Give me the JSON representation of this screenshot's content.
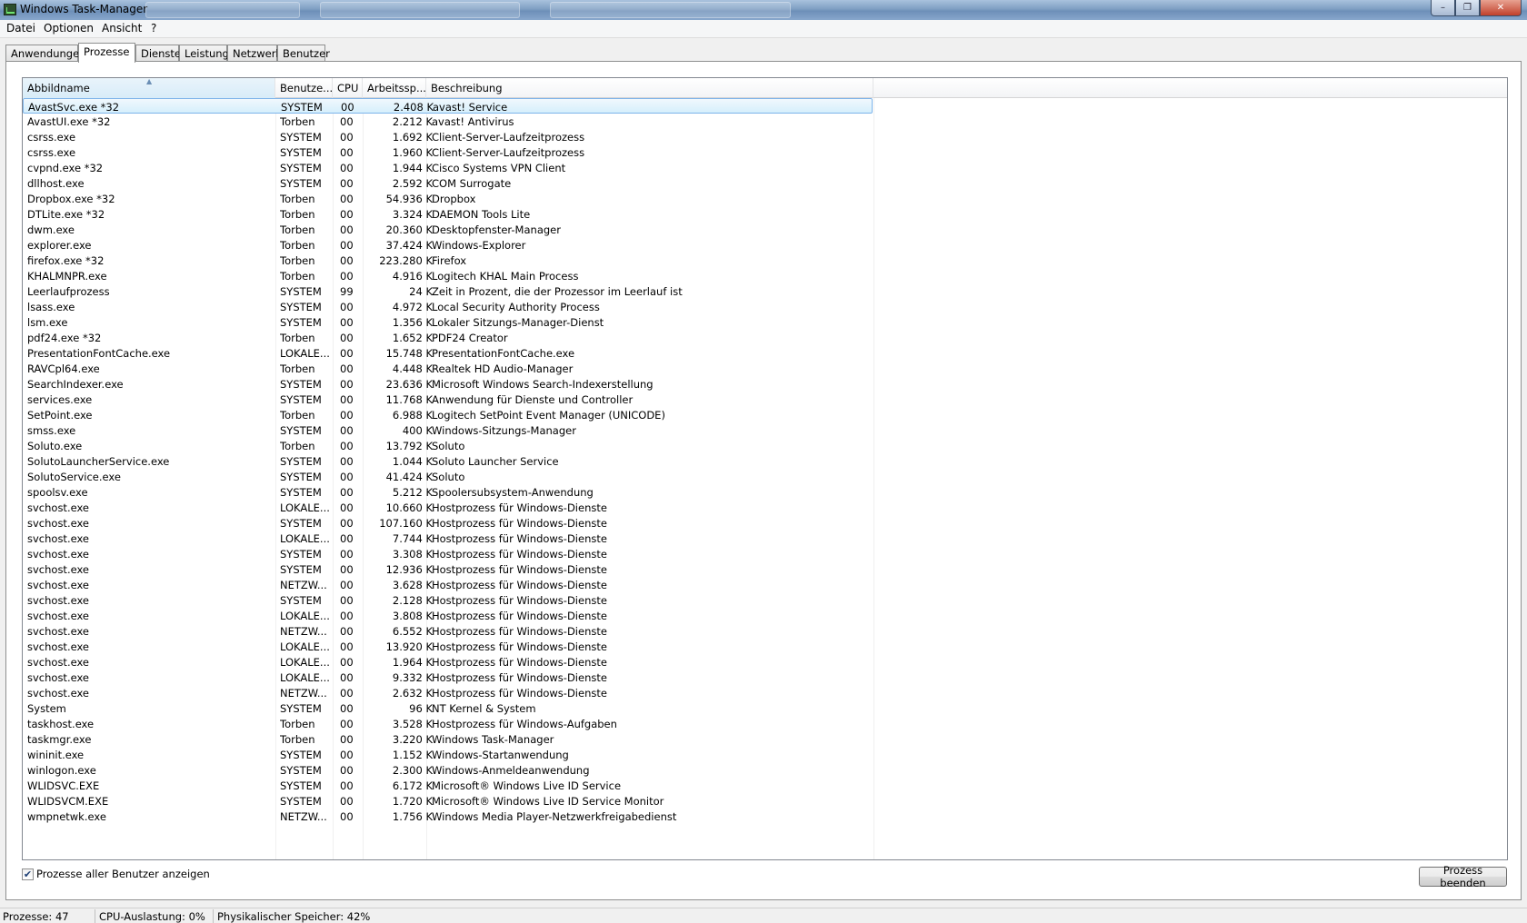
{
  "window": {
    "title": "Windows Task-Manager"
  },
  "menu": [
    "Datei",
    "Optionen",
    "Ansicht",
    "?"
  ],
  "tabs": [
    "Anwendungen",
    "Prozesse",
    "Dienste",
    "Leistung",
    "Netzwerk",
    "Benutzer"
  ],
  "active_tab": "Prozesse",
  "columns": [
    "Abbildname",
    "Benutze...",
    "CPU",
    "Arbeitssp...",
    "Beschreibung"
  ],
  "sorted_column": "Abbildname",
  "processes": [
    [
      "AvastSvc.exe *32",
      "SYSTEM",
      "00",
      "2.408 K",
      "avast! Service"
    ],
    [
      "AvastUI.exe *32",
      "Torben",
      "00",
      "2.212 K",
      "avast! Antivirus"
    ],
    [
      "csrss.exe",
      "SYSTEM",
      "00",
      "1.692 K",
      "Client-Server-Laufzeitprozess"
    ],
    [
      "csrss.exe",
      "SYSTEM",
      "00",
      "1.960 K",
      "Client-Server-Laufzeitprozess"
    ],
    [
      "cvpnd.exe *32",
      "SYSTEM",
      "00",
      "1.944 K",
      "Cisco Systems VPN Client"
    ],
    [
      "dllhost.exe",
      "SYSTEM",
      "00",
      "2.592 K",
      "COM Surrogate"
    ],
    [
      "Dropbox.exe *32",
      "Torben",
      "00",
      "54.936 K",
      "Dropbox"
    ],
    [
      "DTLite.exe *32",
      "Torben",
      "00",
      "3.324 K",
      "DAEMON Tools Lite"
    ],
    [
      "dwm.exe",
      "Torben",
      "00",
      "20.360 K",
      "Desktopfenster-Manager"
    ],
    [
      "explorer.exe",
      "Torben",
      "00",
      "37.424 K",
      "Windows-Explorer"
    ],
    [
      "firefox.exe *32",
      "Torben",
      "00",
      "223.280 K",
      "Firefox"
    ],
    [
      "KHALMNPR.exe",
      "Torben",
      "00",
      "4.916 K",
      "Logitech KHAL Main Process"
    ],
    [
      "Leerlaufprozess",
      "SYSTEM",
      "99",
      "24 K",
      "Zeit in Prozent, die der Prozessor im Leerlauf ist"
    ],
    [
      "lsass.exe",
      "SYSTEM",
      "00",
      "4.972 K",
      "Local Security Authority Process"
    ],
    [
      "lsm.exe",
      "SYSTEM",
      "00",
      "1.356 K",
      "Lokaler Sitzungs-Manager-Dienst"
    ],
    [
      "pdf24.exe *32",
      "Torben",
      "00",
      "1.652 K",
      "PDF24 Creator"
    ],
    [
      "PresentationFontCache.exe",
      "LOKALE...",
      "00",
      "15.748 K",
      "PresentationFontCache.exe"
    ],
    [
      "RAVCpl64.exe",
      "Torben",
      "00",
      "4.448 K",
      "Realtek HD Audio-Manager"
    ],
    [
      "SearchIndexer.exe",
      "SYSTEM",
      "00",
      "23.636 K",
      "Microsoft Windows Search-Indexerstellung"
    ],
    [
      "services.exe",
      "SYSTEM",
      "00",
      "11.768 K",
      "Anwendung für Dienste und Controller"
    ],
    [
      "SetPoint.exe",
      "Torben",
      "00",
      "6.988 K",
      "Logitech SetPoint Event Manager (UNICODE)"
    ],
    [
      "smss.exe",
      "SYSTEM",
      "00",
      "400 K",
      "Windows-Sitzungs-Manager"
    ],
    [
      "Soluto.exe",
      "Torben",
      "00",
      "13.792 K",
      "Soluto"
    ],
    [
      "SolutoLauncherService.exe",
      "SYSTEM",
      "00",
      "1.044 K",
      "Soluto Launcher Service"
    ],
    [
      "SolutoService.exe",
      "SYSTEM",
      "00",
      "41.424 K",
      "Soluto"
    ],
    [
      "spoolsv.exe",
      "SYSTEM",
      "00",
      "5.212 K",
      "Spoolersubsystem-Anwendung"
    ],
    [
      "svchost.exe",
      "LOKALE...",
      "00",
      "10.660 K",
      "Hostprozess für Windows-Dienste"
    ],
    [
      "svchost.exe",
      "SYSTEM",
      "00",
      "107.160 K",
      "Hostprozess für Windows-Dienste"
    ],
    [
      "svchost.exe",
      "LOKALE...",
      "00",
      "7.744 K",
      "Hostprozess für Windows-Dienste"
    ],
    [
      "svchost.exe",
      "SYSTEM",
      "00",
      "3.308 K",
      "Hostprozess für Windows-Dienste"
    ],
    [
      "svchost.exe",
      "SYSTEM",
      "00",
      "12.936 K",
      "Hostprozess für Windows-Dienste"
    ],
    [
      "svchost.exe",
      "NETZW...",
      "00",
      "3.628 K",
      "Hostprozess für Windows-Dienste"
    ],
    [
      "svchost.exe",
      "SYSTEM",
      "00",
      "2.128 K",
      "Hostprozess für Windows-Dienste"
    ],
    [
      "svchost.exe",
      "LOKALE...",
      "00",
      "3.808 K",
      "Hostprozess für Windows-Dienste"
    ],
    [
      "svchost.exe",
      "NETZW...",
      "00",
      "6.552 K",
      "Hostprozess für Windows-Dienste"
    ],
    [
      "svchost.exe",
      "LOKALE...",
      "00",
      "13.920 K",
      "Hostprozess für Windows-Dienste"
    ],
    [
      "svchost.exe",
      "LOKALE...",
      "00",
      "1.964 K",
      "Hostprozess für Windows-Dienste"
    ],
    [
      "svchost.exe",
      "LOKALE...",
      "00",
      "9.332 K",
      "Hostprozess für Windows-Dienste"
    ],
    [
      "svchost.exe",
      "NETZW...",
      "00",
      "2.632 K",
      "Hostprozess für Windows-Dienste"
    ],
    [
      "System",
      "SYSTEM",
      "00",
      "96 K",
      "NT Kernel & System"
    ],
    [
      "taskhost.exe",
      "Torben",
      "00",
      "3.528 K",
      "Hostprozess für Windows-Aufgaben"
    ],
    [
      "taskmgr.exe",
      "Torben",
      "00",
      "3.220 K",
      "Windows Task-Manager"
    ],
    [
      "wininit.exe",
      "SYSTEM",
      "00",
      "1.152 K",
      "Windows-Startanwendung"
    ],
    [
      "winlogon.exe",
      "SYSTEM",
      "00",
      "2.300 K",
      "Windows-Anmeldeanwendung"
    ],
    [
      "WLIDSVC.EXE",
      "SYSTEM",
      "00",
      "6.172 K",
      "Microsoft® Windows Live ID Service"
    ],
    [
      "WLIDSVCM.EXE",
      "SYSTEM",
      "00",
      "1.720 K",
      "Microsoft® Windows Live ID Service Monitor"
    ],
    [
      "wmpnetwk.exe",
      "NETZW...",
      "00",
      "1.756 K",
      "Windows Media Player-Netzwerkfreigabedienst"
    ]
  ],
  "selected_row": 0,
  "show_all_users": {
    "label": "Prozesse aller Benutzer anzeigen",
    "checked": true
  },
  "end_process_button": "Prozess beenden",
  "status": {
    "processes": "Prozesse: 47",
    "cpu": "CPU-Auslastung: 0%",
    "memory": "Physikalischer Speicher: 42%"
  },
  "icons": {
    "window": "task-manager-icon",
    "check": "checkmark-icon",
    "sort": "sort-ascending-icon"
  }
}
